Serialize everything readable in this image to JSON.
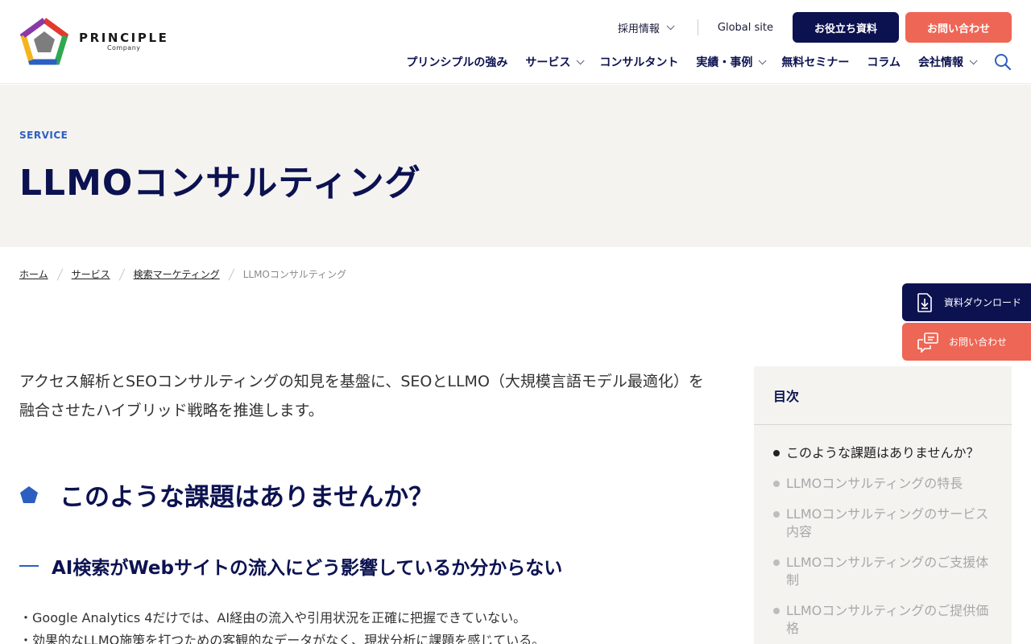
{
  "header": {
    "logo": {
      "word": "PRINCIPLE",
      "sub": "Company"
    },
    "util": {
      "recruit": "採用情報",
      "global": "Global site",
      "docs_button": "お役立ち資料",
      "contact_button": "お問い合わせ"
    },
    "nav": [
      {
        "label": "プリンシプルの強み",
        "has_menu": false
      },
      {
        "label": "サービス",
        "has_menu": true
      },
      {
        "label": "コンサルタント",
        "has_menu": false
      },
      {
        "label": "実績・事例",
        "has_menu": true
      },
      {
        "label": "無料セミナー",
        "has_menu": false
      },
      {
        "label": "コラム",
        "has_menu": false
      },
      {
        "label": "会社情報",
        "has_menu": true
      }
    ]
  },
  "hero": {
    "eyebrow": "SERVICE",
    "title": "LLMOコンサルティング"
  },
  "breadcrumb": {
    "items": [
      "ホーム",
      "サービス",
      "検索マーケティング"
    ],
    "current": "LLMOコンサルティング"
  },
  "floating": {
    "docs": "資料ダウンロード",
    "contact": "お問い合わせ"
  },
  "main": {
    "lead": "アクセス解析とSEOコンサルティングの知見を基盤に、SEOとLLMO（大規模言語モデル最適化）を融合させたハイブリッド戦略を推進します。",
    "h2": "このような課題はありませんか？",
    "h3": "AI検索がWebサイトの流入にどう影響しているか分からない",
    "bullets": [
      "・Google Analytics 4だけでは、AI経由の流入や引用状況を正確に把握できていない。",
      "・効果的なLLMO施策を打つための客観的なデータがなく、現状分析に課題を感じている。"
    ]
  },
  "toc": {
    "title": "目次",
    "items": [
      "このような課題はありませんか？",
      "LLMOコンサルティングの特長",
      "LLMOコンサルティングのサービス内容",
      "LLMOコンサルティングのご支援体制",
      "LLMOコンサルティングのご提供価格"
    ]
  },
  "colors": {
    "navy": "#0c1250",
    "coral": "#ee6655",
    "accent_blue": "#2d5fc1",
    "hero_bg": "#f4f3f0"
  }
}
